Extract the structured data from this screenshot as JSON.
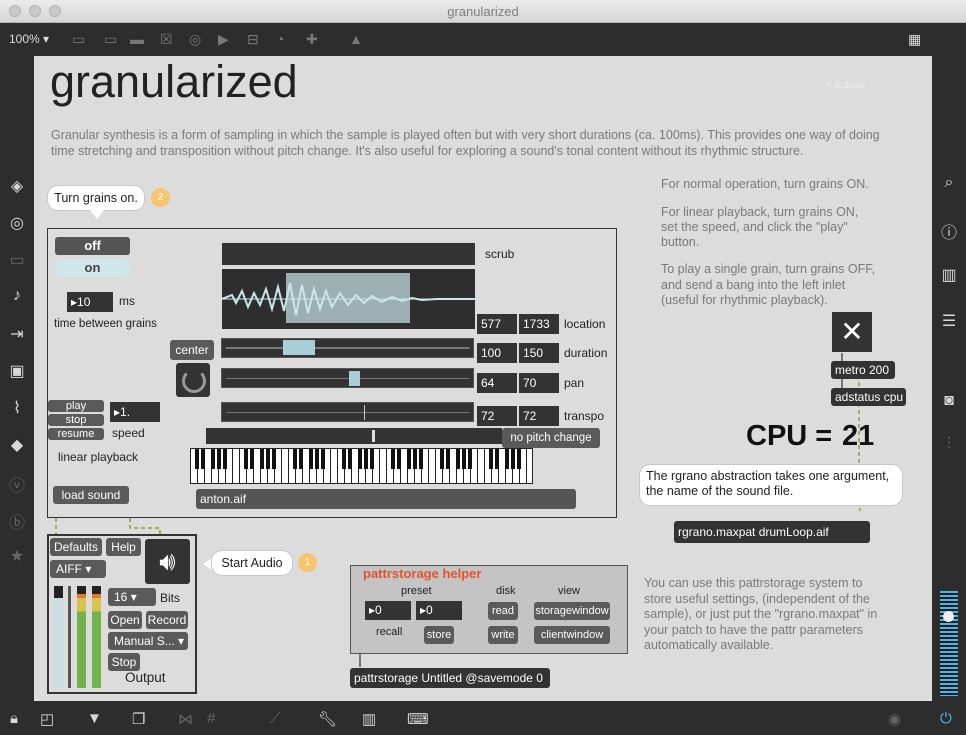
{
  "window": {
    "title": "granularized"
  },
  "toolbar": {
    "zoom": "100%"
  },
  "patch": {
    "heading": "granularized",
    "tag": "< & zoav",
    "description_line1": "Granular synthesis is a form of sampling in which the sample is played often but with very short durations (ca. 100ms). This provides one way of doing",
    "description_line2": "time stretching and transposition without pitch change. It's also useful for exploring a sound's tonal content without its rhythmic structure.",
    "instructions": [
      "For normal operation, turn grains ON.",
      "For linear playback, turn grains ON,",
      "set the speed, and click the \"play\"",
      "button.",
      "To play a single grain, turn grains OFF,",
      "and send a bang into the left inlet",
      "(useful for rhythmic playback)."
    ]
  },
  "callouts": {
    "grains": "Turn grains on.",
    "grains_badge": "2",
    "audio": "Start Audio",
    "audio_badge": "1",
    "rgrano_line1": "The rgrano abstraction takes one argument,",
    "rgrano_line2": "the name of the sound file."
  },
  "grains_panel": {
    "off_label": "off",
    "on_label": "on",
    "interval_value": "10",
    "interval_unit": "ms",
    "interval_label": "time between grains",
    "center_label": "center",
    "play_label": "play",
    "stop_label": "stop",
    "resume_label": "resume",
    "speed_value": "1.",
    "speed_label": "speed",
    "linear_label": "linear playback",
    "load_label": "load sound",
    "scrub_label": "scrub",
    "file_name": "anton.aif",
    "no_pitch_label": "no pitch change",
    "params": [
      {
        "label": "location",
        "min": "577",
        "max": "1733"
      },
      {
        "label": "duration",
        "min": "100",
        "max": "150"
      },
      {
        "label": "pan",
        "min": "64",
        "max": "70"
      },
      {
        "label": "transpo",
        "min": "72",
        "max": "72"
      }
    ]
  },
  "audio_panel": {
    "defaults": "Defaults",
    "help": "Help",
    "format": "AIFF",
    "bits_value": "16",
    "bits_label": "Bits",
    "open": "Open",
    "record": "Record",
    "mode": "Manual S...",
    "stop": "Stop",
    "output": "Output"
  },
  "cpu": {
    "metro": "metro 200",
    "adstatus": "adstatus cpu",
    "label": "CPU =",
    "value": "21"
  },
  "rgrano_object": "rgrano.maxpat drumLoop.aif",
  "pattr": {
    "title": "pattrstorage helper",
    "preset_label": "preset",
    "disk_label": "disk",
    "view_label": "view",
    "preset_a": "0",
    "preset_b": "0",
    "recall_label": "recall",
    "store": "store",
    "read": "read",
    "write": "write",
    "storagewindow": "storagewindow",
    "clientwindow": "clientwindow",
    "object": "pattrstorage Untitled @savemode 0",
    "note_lines": [
      "You can use this pattrstorage system  to",
      "store useful settings, (independent of the",
      "sample), or just put the \"rgrano.maxpat\" in",
      "your patch to have the pattr parameters",
      "automatically available."
    ]
  },
  "colors": {
    "accent": "#f7c56d",
    "pattr_title": "#e2542b",
    "waveform": "#c9e6ea"
  }
}
